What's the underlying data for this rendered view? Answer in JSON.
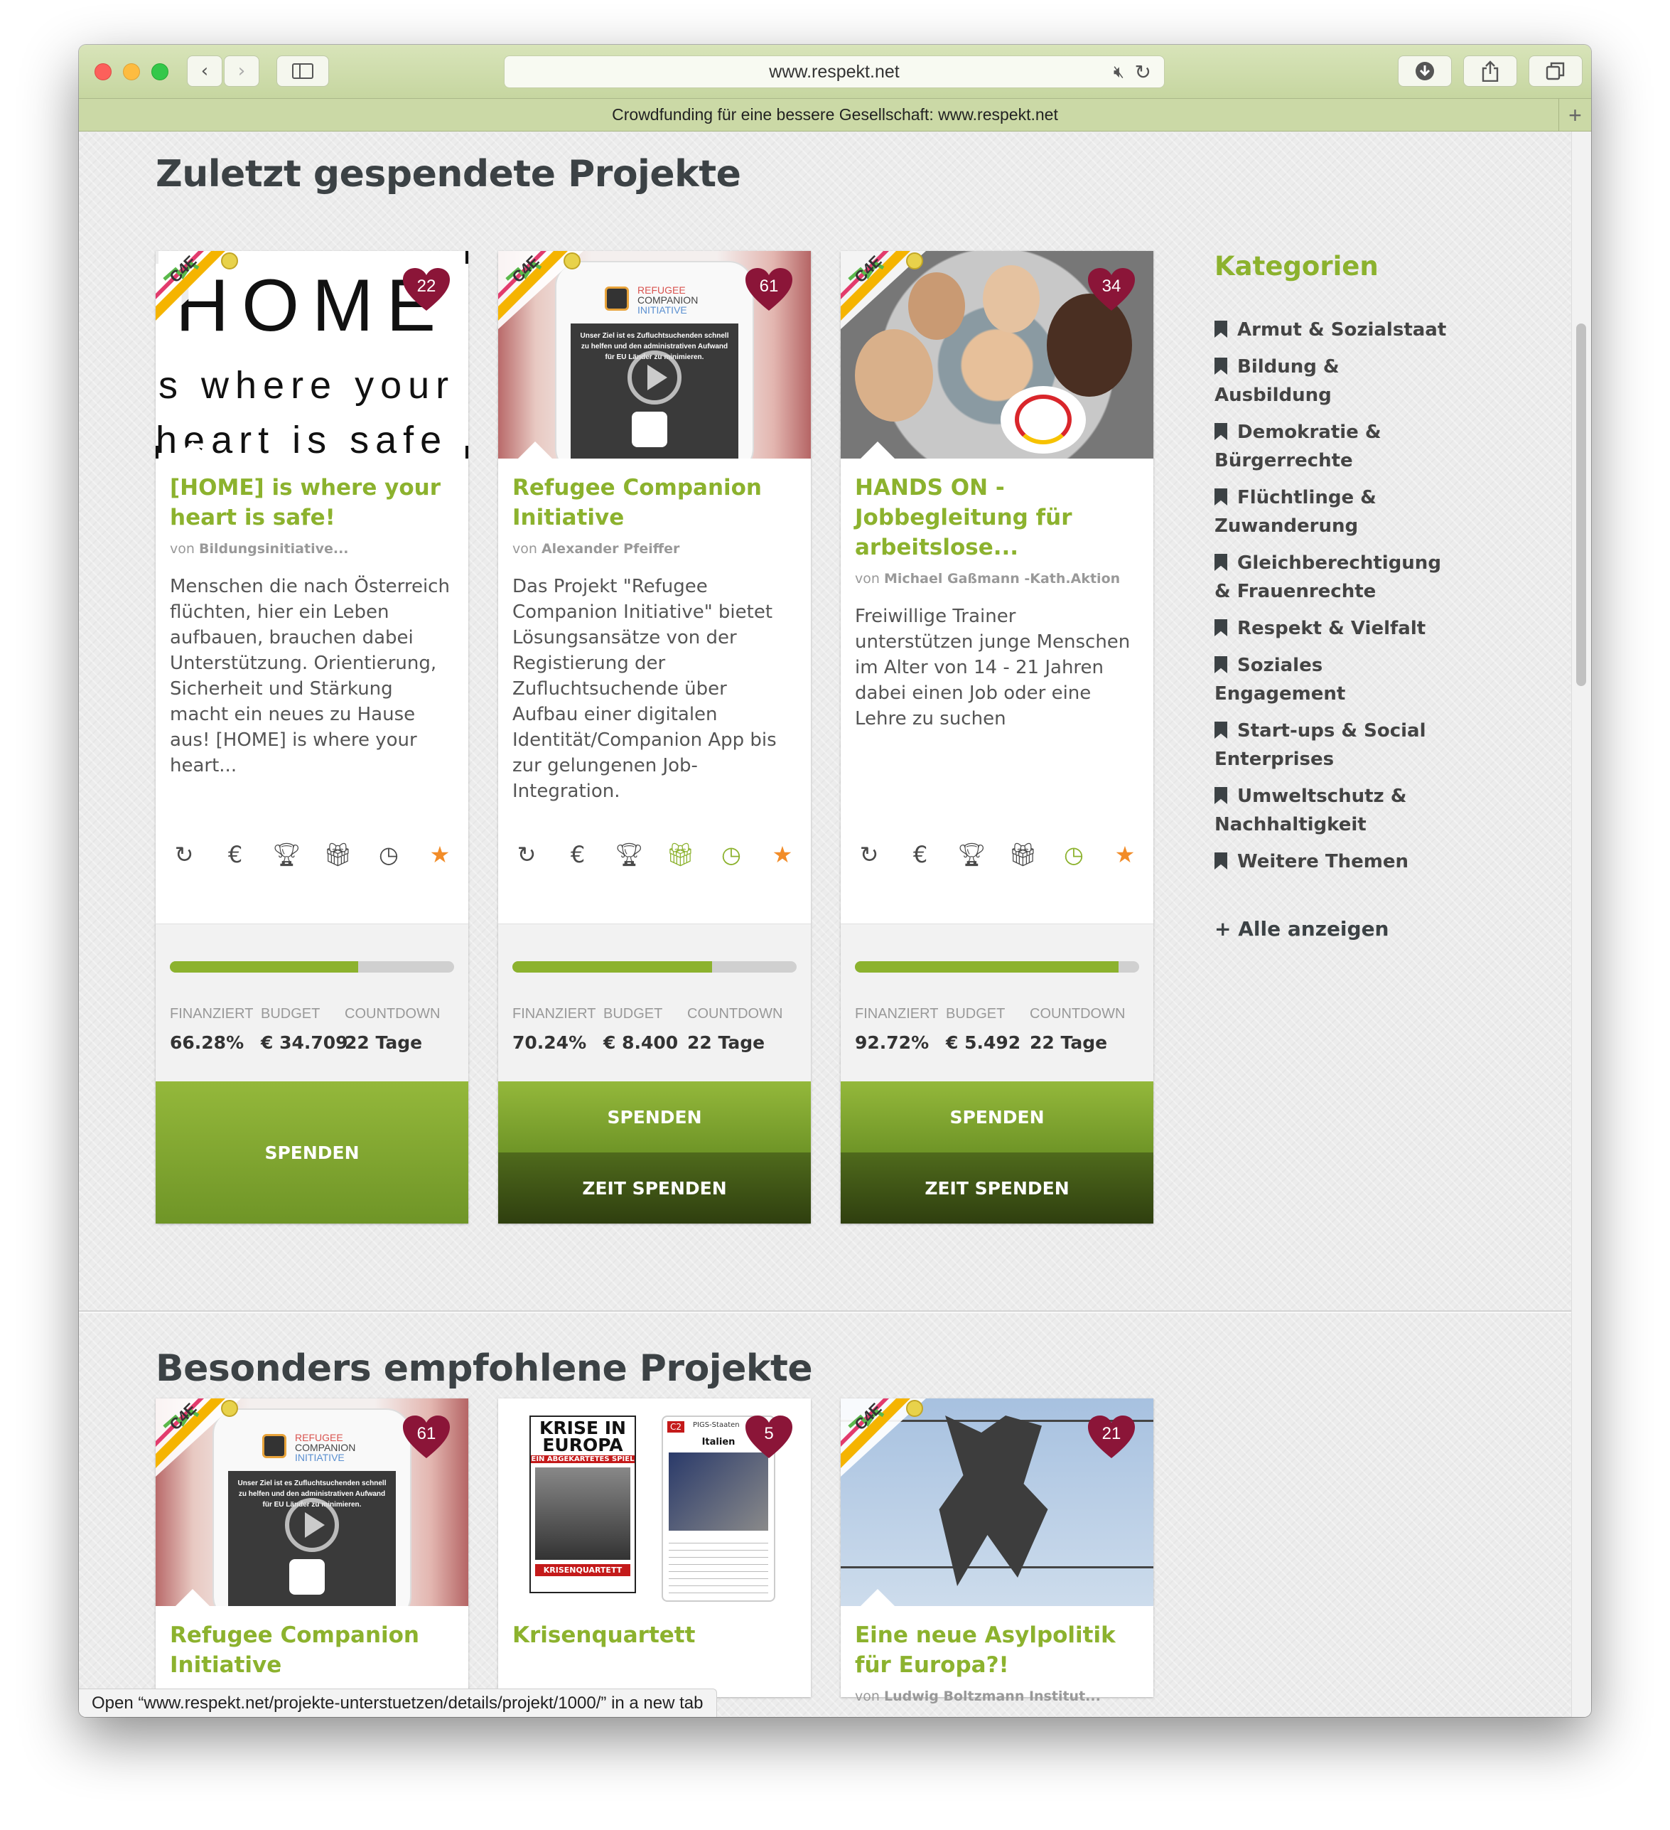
{
  "browser": {
    "url": "www.respekt.net",
    "tab_title": "Crowdfunding für eine bessere Gesellschaft: www.respekt.net",
    "status_prefix": "Open “",
    "status_link": "www.respekt.net/projekte-unterstuetzen/details/projekt/1000/",
    "status_suffix": "” in a new tab"
  },
  "sections": {
    "recent_title": "Zuletzt gespendete Projekte",
    "featured_title": "Besonders empfohlene Projekte"
  },
  "stat_labels": {
    "funded": "FINANZIERT",
    "budget": "BUDGET",
    "countdown": "COUNTDOWN"
  },
  "buttons": {
    "donate": "SPENDEN",
    "donate_time": "ZEIT SPENDEN"
  },
  "recent_projects": [
    {
      "likes": "22",
      "image_text": [
        "HOME",
        "s where your",
        "heart is safe"
      ],
      "title": "[HOME] is where your heart is safe!",
      "by_prefix": "von",
      "author": "Bildungsinitiative...",
      "description": "Menschen die nach Österreich flüchten, hier ein Leben aufbauen, brauchen dabei Unterstützung. Orientierung, Sicherheit und Stärkung macht ein neues zu Hause aus! [HOME] is where your heart...",
      "funded": "66.28%",
      "funded_fraction": 0.6628,
      "budget": "€ 34.709",
      "countdown": "22 Tage",
      "has_time_donation": false
    },
    {
      "likes": "61",
      "image_text": [
        "REFUGEE",
        "COMPANION",
        "INITIATIVE",
        "Unser Ziel ist es Zufluchtsuchenden schnell zu helfen und den administrativen Aufwand für EU Länder zu minimieren."
      ],
      "title": "Refugee Companion Initiative",
      "by_prefix": "von",
      "author": "Alexander Pfeiffer",
      "description": "Das Projekt \"Refugee Companion Initiative\" bietet Lösungsansätze von der Registierung der Zufluchtsuchende über Aufbau einer digitalen Identität/Companion App bis zur gelungenen Job-Integration.",
      "funded": "70.24%",
      "funded_fraction": 0.7024,
      "budget": "€ 8.400",
      "countdown": "22 Tage",
      "has_time_donation": true
    },
    {
      "likes": "34",
      "title": "HANDS ON - Jobbegleitung für arbeitslose...",
      "by_prefix": "von",
      "author": "Michael Gaßmann -Kath.Aktion",
      "description": "Freiwillige Trainer unterstützen junge Menschen im Alter von 14 - 21 Jahren dabei einen Job oder eine Lehre zu suchen",
      "funded": "92.72%",
      "funded_fraction": 0.9272,
      "budget": "€ 5.492",
      "countdown": "22 Tage",
      "has_time_donation": true
    }
  ],
  "featured_projects": [
    {
      "likes": "61",
      "title": "Refugee Companion Initiative",
      "image_text": [
        "REFUGEE",
        "COMPANION",
        "INITIATIVE",
        "Unser Ziel ist es Zufluchtsuchenden schnell zu helfen und den administrativen Aufwand für EU Länder zu minimieren."
      ]
    },
    {
      "likes": "5",
      "title": "Krisenquartett",
      "image_text": [
        "KRISE IN",
        "EUROPA",
        "EIN ABGEKARTETES SPIEL",
        "KRISENQUARTETT",
        "C2",
        "PIGS-Staaten",
        "Italien"
      ]
    },
    {
      "likes": "21",
      "title": "Eine neue Asylpolitik für Europa?!",
      "by_prefix": "von",
      "author": "Ludwig Boltzmann Institut..."
    }
  ],
  "sidebar": {
    "title": "Kategorien",
    "categories": [
      "Armut & Sozialstaat",
      "Bildung & Ausbildung",
      "Demokratie & Bürgerrechte",
      "Flüchtlinge & Zuwanderung",
      "Gleichberechtigung & Frauenrechte",
      "Respekt & Vielfalt",
      "Soziales Engagement",
      "Start-ups & Social Enterprises",
      "Umweltschutz & Nachhaltigkeit",
      "Weitere Themen"
    ],
    "show_all": "+ Alle anzeigen"
  },
  "icons": [
    "recurring-icon",
    "euro-icon",
    "trophy-icon",
    "gift-icon",
    "clock-icon",
    "star-icon"
  ],
  "colors": {
    "accent": "#8cb22e",
    "heart": "#8b1538",
    "dark_button": "#3a4d14",
    "heading": "#3c4245"
  }
}
